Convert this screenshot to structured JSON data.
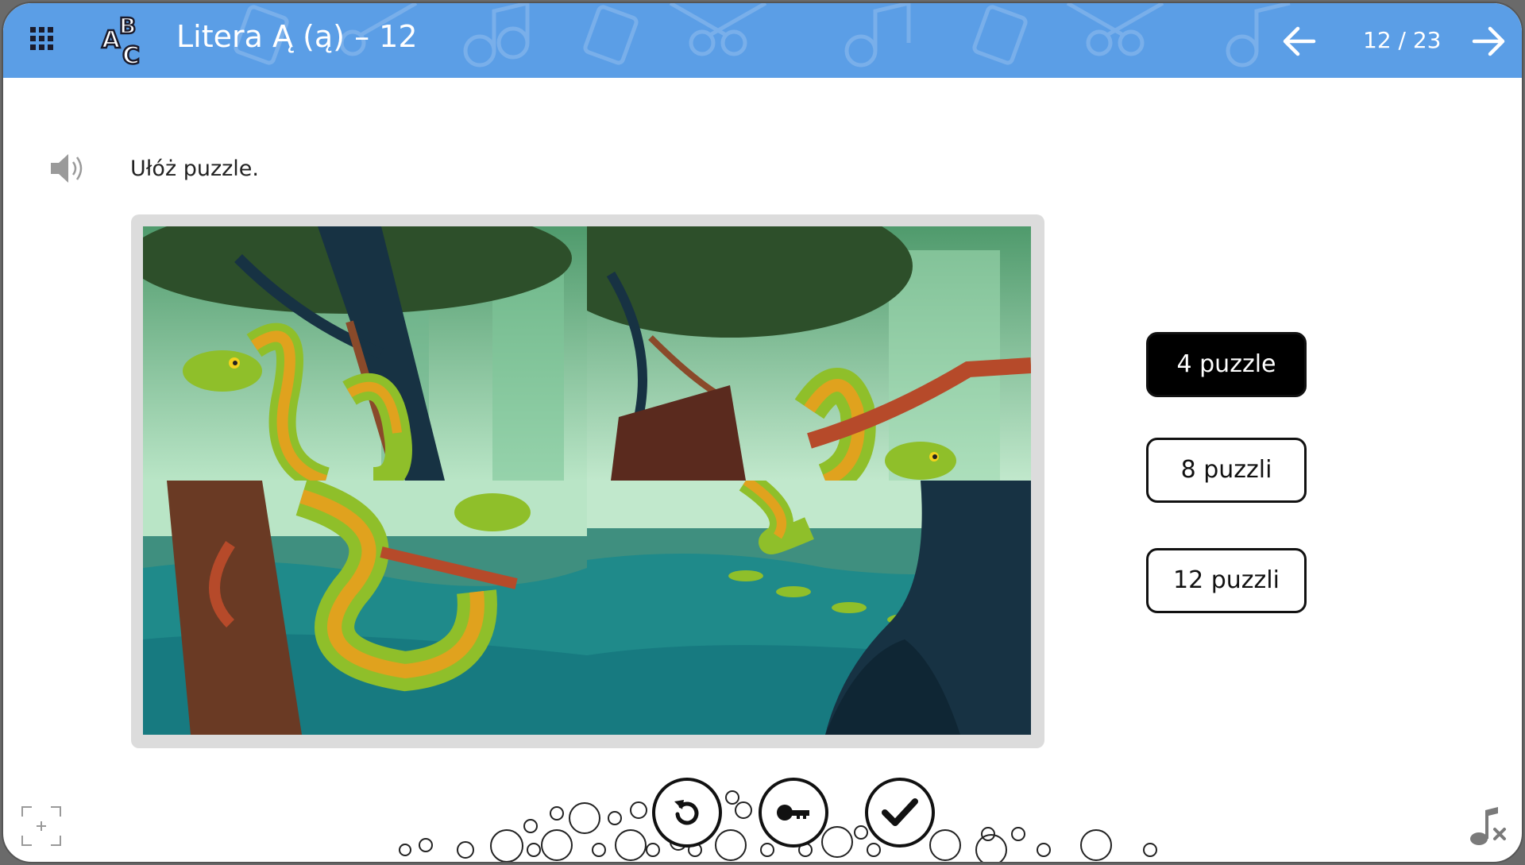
{
  "header": {
    "menu_icon": "grid-menu-icon",
    "logo_icon": "abc-letters-icon",
    "title": "Litera Ą (ą) – 12",
    "page_indicator": "12 / 23",
    "prev_icon": "arrow-left-icon",
    "next_icon": "arrow-right-icon",
    "color": "#5b9ee6"
  },
  "exercise": {
    "speaker_icon": "speaker-icon",
    "instruction": "Ułóż puzzle."
  },
  "puzzle_options": [
    {
      "label": "4 puzzle",
      "selected": true
    },
    {
      "label": "8 puzzli",
      "selected": false
    },
    {
      "label": "12 puzzli",
      "selected": false
    }
  ],
  "controls": {
    "reset_icon": "reset-icon",
    "key_icon": "key-icon",
    "check_icon": "check-icon",
    "fullscreen_icon": "fullscreen-icon",
    "music_icon": "music-off-icon"
  }
}
